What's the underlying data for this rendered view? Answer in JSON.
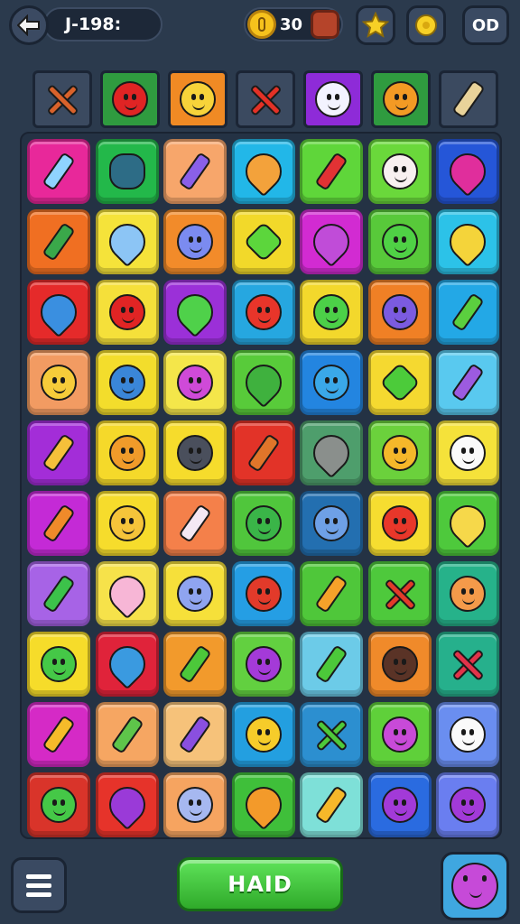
{
  "header": {
    "level_text": "J-198:",
    "coins": "30",
    "menu_label": "OD"
  },
  "footer": {
    "play_label": "HAID"
  },
  "tools": [
    {
      "name": "cross-icon",
      "bg": "#3b4a60",
      "kind": "cross",
      "color": "#d9622b"
    },
    {
      "name": "bomb-icon",
      "bg": "#2f9b3f",
      "kind": "face",
      "color": "#e02424"
    },
    {
      "name": "smiley-icon",
      "bg": "#f08a24",
      "kind": "face",
      "color": "#f7d33a"
    },
    {
      "name": "cross-icon",
      "bg": "#3b4a60",
      "kind": "cross",
      "color": "#e33126"
    },
    {
      "name": "ghost-icon",
      "bg": "#8e2bd8",
      "kind": "face",
      "color": "#f3f3ff"
    },
    {
      "name": "sun-icon",
      "bg": "#2f9b3f",
      "kind": "face",
      "color": "#f39a24"
    },
    {
      "name": "pencil-icon",
      "bg": "#3b4a60",
      "kind": "pen",
      "color": "#e9d39a"
    }
  ],
  "board": [
    [
      {
        "bg": "#e8289a",
        "k": "pen",
        "c": "#8fd3ff",
        "n": "pencil-icon"
      },
      {
        "bg": "#23b84a",
        "k": "spiky",
        "c": "#2d6c86",
        "n": "sun-icon"
      },
      {
        "bg": "#f7a66b",
        "k": "pen",
        "c": "#8a60e8",
        "n": "pencil-icon"
      },
      {
        "bg": "#22b7e8",
        "k": "drop",
        "c": "#f3a23b",
        "n": "candy-icon"
      },
      {
        "bg": "#5fd63a",
        "k": "pen",
        "c": "#e23234",
        "n": "pencil-icon"
      },
      {
        "bg": "#6ad83b",
        "k": "face",
        "c": "#f8f0f0",
        "n": "ghost-icon"
      },
      {
        "bg": "#2556d8",
        "k": "drop",
        "c": "#e02e9c",
        "n": "berry-icon"
      }
    ],
    [
      {
        "bg": "#f06f22",
        "k": "pen",
        "c": "#3aa84a",
        "n": "pencil-icon"
      },
      {
        "bg": "#f5e33a",
        "k": "drop",
        "c": "#8cc5f5",
        "n": "candy-icon"
      },
      {
        "bg": "#f28b2a",
        "k": "face",
        "c": "#7b8bf0",
        "n": "blob-icon"
      },
      {
        "bg": "#f2d92a",
        "k": "square",
        "c": "#5cd63c",
        "n": "cube-icon"
      },
      {
        "bg": "#d22bd2",
        "k": "drop",
        "c": "#c04cd8",
        "n": "fruit-icon"
      },
      {
        "bg": "#58c93a",
        "k": "face",
        "c": "#4fd145",
        "n": "virus-icon"
      },
      {
        "bg": "#2cc2e8",
        "k": "drop",
        "c": "#f4d43a",
        "n": "star-icon"
      }
    ],
    [
      {
        "bg": "#e52a2a",
        "k": "drop",
        "c": "#3a8fe0",
        "n": "leaf-icon"
      },
      {
        "bg": "#f5e03a",
        "k": "face",
        "c": "#e12424",
        "n": "bomb-icon"
      },
      {
        "bg": "#9b30d8",
        "k": "drop",
        "c": "#4fd14a",
        "n": "leaf-icon"
      },
      {
        "bg": "#26a7e0",
        "k": "face",
        "c": "#e8352a",
        "n": "virus-icon"
      },
      {
        "bg": "#f3d82c",
        "k": "face",
        "c": "#4cd048",
        "n": "smiley-icon"
      },
      {
        "bg": "#f08025",
        "k": "face",
        "c": "#7b5be0",
        "n": "blob-icon"
      },
      {
        "bg": "#23a8e6",
        "k": "pen",
        "c": "#5bcf3f",
        "n": "bottle-icon"
      }
    ],
    [
      {
        "bg": "#f29b62",
        "k": "face",
        "c": "#f6cc3a",
        "n": "smiley-icon"
      },
      {
        "bg": "#f3dd2c",
        "k": "face",
        "c": "#3a86d8",
        "n": "bomb-icon"
      },
      {
        "bg": "#f4e64a",
        "k": "face",
        "c": "#cf4ad8",
        "n": "blob-icon"
      },
      {
        "bg": "#58cb3a",
        "k": "drop",
        "c": "#3fb13e",
        "n": "leaf-icon"
      },
      {
        "bg": "#2385e0",
        "k": "face",
        "c": "#3aa8e8",
        "n": "smiley-icon"
      },
      {
        "bg": "#f5d930",
        "k": "square",
        "c": "#4ccb3a",
        "n": "cube-icon"
      },
      {
        "bg": "#59c9ef",
        "k": "pen",
        "c": "#9c5be0",
        "n": "tag-icon"
      }
    ],
    [
      {
        "bg": "#a32dd8",
        "k": "pen",
        "c": "#f5c03a",
        "n": "pencil-icon"
      },
      {
        "bg": "#f5d92a",
        "k": "face",
        "c": "#f09b2a",
        "n": "smiley-icon"
      },
      {
        "bg": "#f6dc2c",
        "k": "face",
        "c": "#4a4f5c",
        "n": "blob-icon"
      },
      {
        "bg": "#e23328",
        "k": "pen",
        "c": "#e0752a",
        "n": "crayon-icon"
      },
      {
        "bg": "#4e9e6c",
        "k": "drop",
        "c": "#8a8f8c",
        "n": "rock-icon"
      },
      {
        "bg": "#6bd13c",
        "k": "face",
        "c": "#f5b82a",
        "n": "sun-icon"
      },
      {
        "bg": "#f5e23a",
        "k": "face",
        "c": "#fafafa",
        "n": "ghost-icon"
      }
    ],
    [
      {
        "bg": "#c42ad6",
        "k": "pen",
        "c": "#f08a2a",
        "n": "crayon-icon"
      },
      {
        "bg": "#f6dc2c",
        "k": "face",
        "c": "#f5c43a",
        "n": "smiley-icon"
      },
      {
        "bg": "#f4804a",
        "k": "pen",
        "c": "#f4e8f4",
        "n": "battery-icon"
      },
      {
        "bg": "#50c63c",
        "k": "face",
        "c": "#3ab548",
        "n": "virus-icon"
      },
      {
        "bg": "#236fb0",
        "k": "face",
        "c": "#6ea0e6",
        "n": "blob-icon"
      },
      {
        "bg": "#f6dd30",
        "k": "face",
        "c": "#e8372a",
        "n": "virus-icon"
      },
      {
        "bg": "#4ec93c",
        "k": "drop",
        "c": "#f6d84a",
        "n": "star-icon"
      }
    ],
    [
      {
        "bg": "#a763e6",
        "k": "pen",
        "c": "#3cc24a",
        "n": "pencil-icon"
      },
      {
        "bg": "#f6e24a",
        "k": "drop",
        "c": "#f7b6d6",
        "n": "candy-icon"
      },
      {
        "bg": "#f6e03a",
        "k": "face",
        "c": "#8fa4f0",
        "n": "blob-icon"
      },
      {
        "bg": "#259ee4",
        "k": "face",
        "c": "#e23a2a",
        "n": "virus-icon"
      },
      {
        "bg": "#4fc73a",
        "k": "pen",
        "c": "#f5a22a",
        "n": "crayon-icon"
      },
      {
        "bg": "#4ec93c",
        "k": "cross",
        "c": "#e23a2a",
        "n": "cross-icon"
      },
      {
        "bg": "#26b28a",
        "k": "face",
        "c": "#f49a4a",
        "n": "orange-icon"
      }
    ],
    [
      {
        "bg": "#f6dc2a",
        "k": "face",
        "c": "#45c847",
        "n": "smiley-icon"
      },
      {
        "bg": "#e0233a",
        "k": "drop",
        "c": "#3a9ae0",
        "n": "candy-icon"
      },
      {
        "bg": "#f29a2c",
        "k": "pen",
        "c": "#4cc83a",
        "n": "pencil-icon"
      },
      {
        "bg": "#62d040",
        "k": "face",
        "c": "#a43ad8",
        "n": "virus-icon"
      },
      {
        "bg": "#6ccbe8",
        "k": "pen",
        "c": "#4cc83a",
        "n": "bottle-icon"
      },
      {
        "bg": "#f08a2a",
        "k": "face",
        "c": "#5a3326",
        "n": "bomb-icon"
      },
      {
        "bg": "#26b08c",
        "k": "cross",
        "c": "#e2334a",
        "n": "cross-icon"
      }
    ],
    [
      {
        "bg": "#d52ac6",
        "k": "pen",
        "c": "#f5bb2a",
        "n": "crayon-icon"
      },
      {
        "bg": "#f6a662",
        "k": "pen",
        "c": "#5ec54a",
        "n": "pencil-icon"
      },
      {
        "bg": "#f6c27a",
        "k": "pen",
        "c": "#8a4fe0",
        "n": "pencil-icon"
      },
      {
        "bg": "#239fe0",
        "k": "face",
        "c": "#f6cc2a",
        "n": "flame-icon"
      },
      {
        "bg": "#2c8fd0",
        "k": "cross",
        "c": "#4ec83a",
        "n": "bottle-icon"
      },
      {
        "bg": "#5fd03a",
        "k": "face",
        "c": "#c84ad8",
        "n": "flower-icon"
      },
      {
        "bg": "#6a8ef0",
        "k": "face",
        "c": "#fafafa",
        "n": "ghost-icon"
      }
    ],
    [
      {
        "bg": "#d9342a",
        "k": "face",
        "c": "#45c847",
        "n": "smiley-icon"
      },
      {
        "bg": "#e6332a",
        "k": "drop",
        "c": "#9a3ad8",
        "n": "berry-icon"
      },
      {
        "bg": "#f6a460",
        "k": "face",
        "c": "#a6b8f0",
        "n": "blob-icon"
      },
      {
        "bg": "#3fbf3a",
        "k": "drop",
        "c": "#f39a2a",
        "n": "bell-icon"
      },
      {
        "bg": "#7ee0d8",
        "k": "pen",
        "c": "#f6b82a",
        "n": "pencil-icon"
      },
      {
        "bg": "#2a6be0",
        "k": "face",
        "c": "#a23ad8",
        "n": "virus-icon"
      },
      {
        "bg": "#6a7ef0",
        "k": "face",
        "c": "#a23ad8",
        "n": "virus-icon"
      }
    ]
  ]
}
